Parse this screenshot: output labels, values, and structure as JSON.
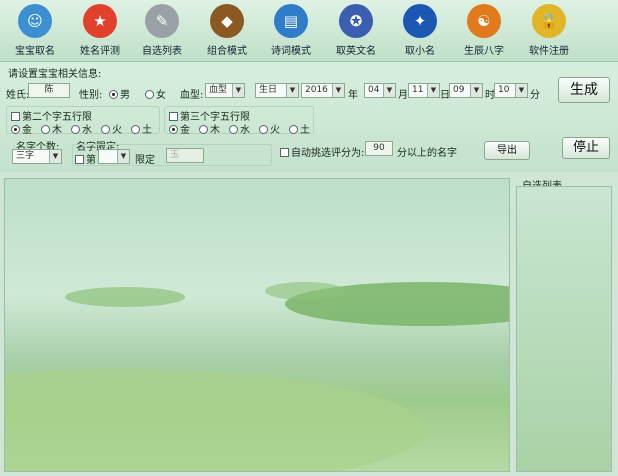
{
  "toolbar": [
    {
      "label": "宝宝取名",
      "icon": "baby-icon",
      "color": "#3c8fd0",
      "glyph": "☺"
    },
    {
      "label": "姓名评测",
      "icon": "medal-icon",
      "color": "#e0402c",
      "glyph": "★"
    },
    {
      "label": "自选列表",
      "icon": "pencil-cup-icon",
      "color": "#9aa1a6",
      "glyph": "✎"
    },
    {
      "label": "组合模式",
      "icon": "lion-icon",
      "color": "#8a5a22",
      "glyph": "◆"
    },
    {
      "label": "诗词模式",
      "icon": "book-icon",
      "color": "#2f7cc9",
      "glyph": "▤"
    },
    {
      "label": "取英文名",
      "icon": "badge-icon",
      "color": "#3a5fb0",
      "glyph": "✪"
    },
    {
      "label": "取小名",
      "icon": "bird-icon",
      "color": "#1d57b4",
      "glyph": "✦"
    },
    {
      "label": "生辰八字",
      "icon": "bagua-icon",
      "color": "#e07a1a",
      "glyph": "☯"
    },
    {
      "label": "软件注册",
      "icon": "lock-icon",
      "color": "#e0b528",
      "glyph": "🔒"
    }
  ],
  "form": {
    "section_title": "请设置宝宝相关信息:",
    "surname_label": "姓氏:",
    "surname_value": "陈",
    "gender_label": "性别:",
    "gender_male": "男",
    "gender_female": "女",
    "blood_label": "血型:",
    "blood_value": "血型",
    "birthday_value": "生日",
    "year_value": "2016",
    "year_unit": "年",
    "month_value": "04",
    "month_unit": "月",
    "day_value": "11",
    "day_unit": "日",
    "hour_value": "09",
    "hour_unit": "时",
    "minute_value": "10",
    "minute_unit": "分",
    "second_char_label": "第二个字五行限",
    "third_char_label": "第三个字五行限",
    "elements": [
      "金",
      "木",
      "水",
      "火",
      "土"
    ],
    "name_count_label": "名字个数:",
    "name_count_value": "三字",
    "name_limit_label": "名字限定:",
    "name_limit_prefix": "第",
    "name_limit_suffix": "限定",
    "limit_char_value": "玉",
    "auto_pick_label": "自动挑选评分为:",
    "auto_pick_value": "90",
    "auto_pick_suffix": "分以上的名字"
  },
  "buttons": {
    "generate": "生成",
    "stop": "停止",
    "export": "导出"
  },
  "side_panel": {
    "title": "自选列表"
  }
}
